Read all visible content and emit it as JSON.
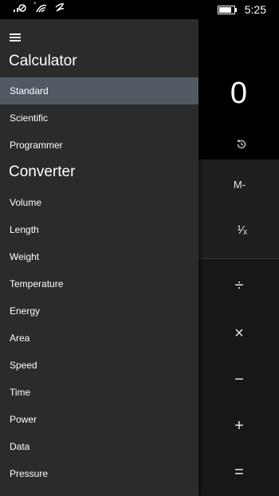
{
  "status": {
    "time": "5:25",
    "icons": [
      "signal-icon",
      "wifi-icon",
      "data-icon",
      "battery-icon"
    ],
    "battery_level": 0.85
  },
  "calculator": {
    "display_value": "0",
    "memory_subtract": "M-",
    "reciprocal": "¹⁄ₓ",
    "operators": {
      "divide": "÷",
      "multiply": "×",
      "minus": "−",
      "plus": "+",
      "equals": "="
    }
  },
  "drawer": {
    "calculator_title": "Calculator",
    "calculator_items": [
      {
        "label": "Standard",
        "selected": true
      },
      {
        "label": "Scientific"
      },
      {
        "label": "Programmer"
      }
    ],
    "converter_title": "Converter",
    "converter_items": [
      {
        "label": "Volume"
      },
      {
        "label": "Length"
      },
      {
        "label": "Weight"
      },
      {
        "label": "Temperature"
      },
      {
        "label": "Energy"
      },
      {
        "label": "Area"
      },
      {
        "label": "Speed"
      },
      {
        "label": "Time"
      },
      {
        "label": "Power"
      },
      {
        "label": "Data"
      },
      {
        "label": "Pressure"
      }
    ]
  },
  "colors": {
    "drawer_bg": "#2b2b2b",
    "selected_bg": "#515a63"
  }
}
